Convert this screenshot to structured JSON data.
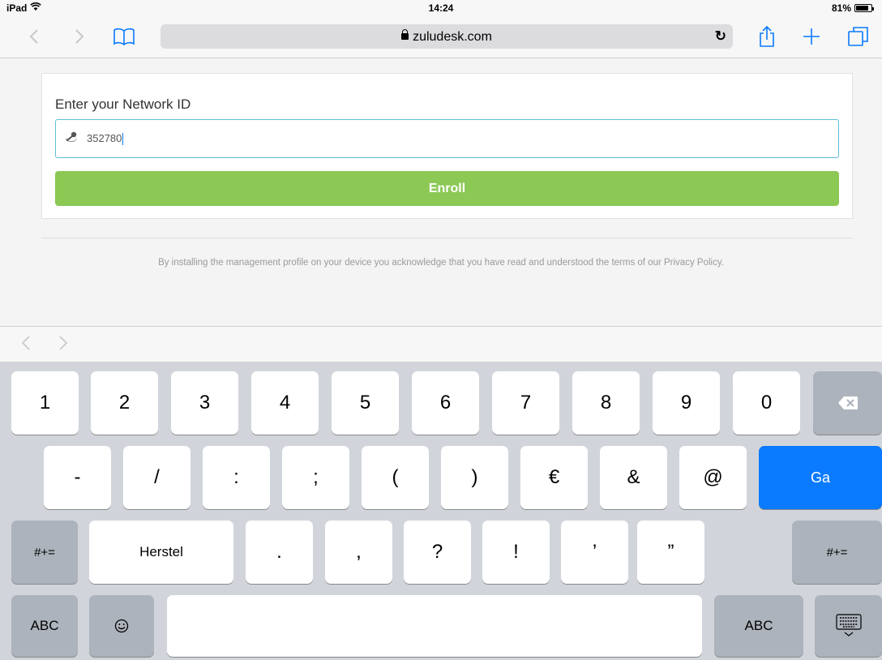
{
  "status_bar": {
    "device": "iPad",
    "time": "14:24",
    "battery_text": "81%",
    "battery_level": 0.81
  },
  "toolbar": {
    "url": "zuludesk.com"
  },
  "page": {
    "heading": "Enter your Network ID",
    "network_id_value": "352780",
    "enroll_label": "Enroll",
    "disclaimer": "By installing the management profile on your device you acknowledge that you have read and understood the terms of our Privacy Policy."
  },
  "keyboard": {
    "row1": [
      "1",
      "2",
      "3",
      "4",
      "5",
      "6",
      "7",
      "8",
      "9",
      "0"
    ],
    "row2": [
      "-",
      "/",
      ":",
      ";",
      "(",
      ")",
      "€",
      "&",
      "@"
    ],
    "go_label": "Ga",
    "row3": [
      "Herstel",
      ".",
      ",",
      "?",
      "!",
      "’",
      "”"
    ],
    "shift_label": "#+=",
    "abc_label": "ABC"
  },
  "colors": {
    "accent": "#0a7aff",
    "enroll_green": "#8bc854",
    "input_border": "#5fbed8"
  }
}
